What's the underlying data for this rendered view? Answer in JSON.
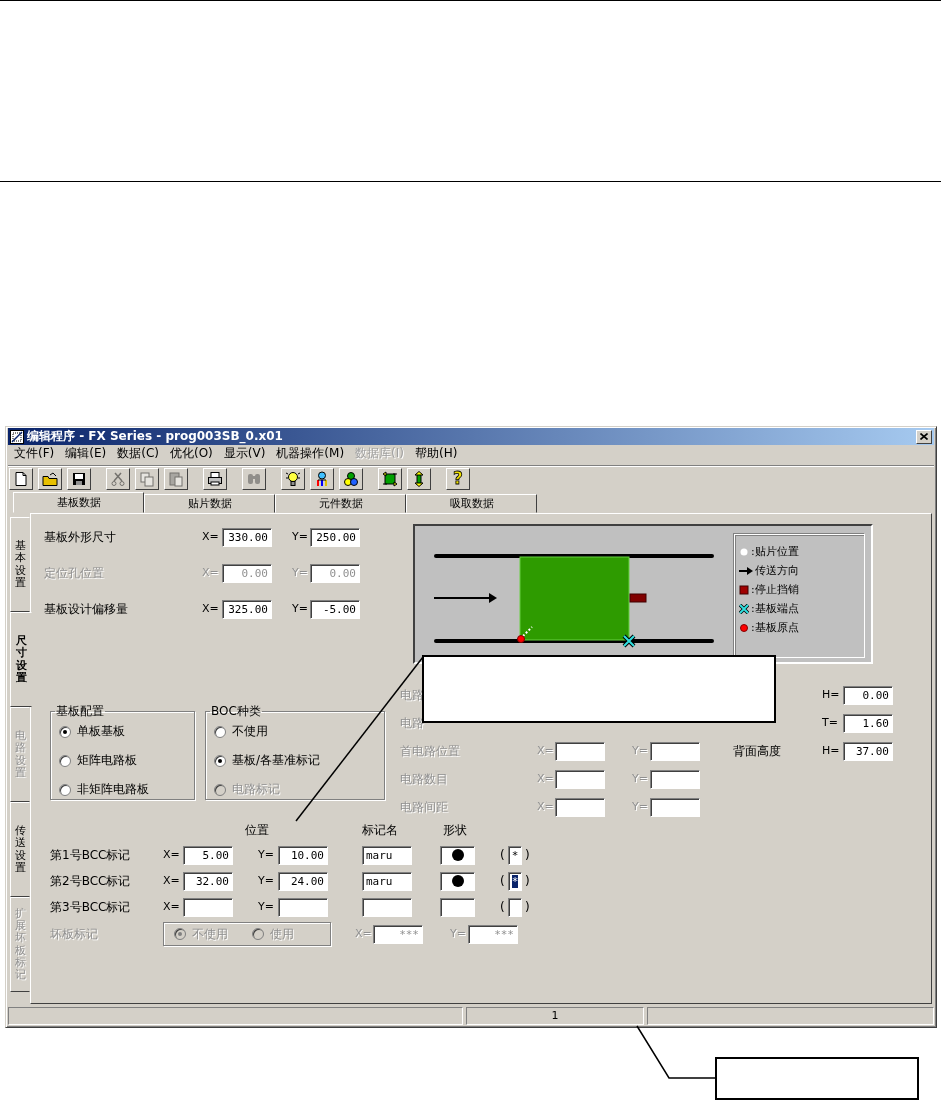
{
  "window": {
    "title": "编辑程序 - FX Series - prog003SB_0.x01"
  },
  "menu": [
    {
      "label": "文件(F)",
      "disabled": false
    },
    {
      "label": "编辑(E)",
      "disabled": false
    },
    {
      "label": "数据(C)",
      "disabled": false
    },
    {
      "label": "优化(O)",
      "disabled": false
    },
    {
      "label": "显示(V)",
      "disabled": false
    },
    {
      "label": "机器操作(M)",
      "disabled": false
    },
    {
      "label": "数据库(I)",
      "disabled": true
    },
    {
      "label": "帮助(H)",
      "disabled": false
    }
  ],
  "toolbar_groups": [
    [
      {
        "kind": "new",
        "disabled": false
      },
      {
        "kind": "open",
        "disabled": false
      },
      {
        "kind": "save",
        "disabled": false
      }
    ],
    [
      {
        "kind": "cut",
        "disabled": true
      },
      {
        "kind": "copy",
        "disabled": true
      },
      {
        "kind": "paste",
        "disabled": true
      }
    ],
    [
      {
        "kind": "print",
        "disabled": false
      }
    ],
    [
      {
        "kind": "find",
        "disabled": true
      }
    ],
    [
      {
        "kind": "bulb",
        "disabled": false
      },
      {
        "kind": "network",
        "disabled": false
      },
      {
        "kind": "shapes",
        "disabled": false
      }
    ],
    [
      {
        "kind": "swap",
        "disabled": false
      },
      {
        "kind": "height",
        "disabled": false
      }
    ],
    [
      {
        "kind": "help",
        "glyph": "?",
        "disabled": false
      }
    ]
  ],
  "tabs": [
    {
      "label": "基板数据",
      "selected": true
    },
    {
      "label": "贴片数据",
      "selected": false
    },
    {
      "label": "元件数据",
      "selected": false
    },
    {
      "label": "吸取数据",
      "selected": false
    }
  ],
  "side_tabs": [
    {
      "label": "基本设置",
      "selected": false,
      "disabled": false
    },
    {
      "label": "尺寸设置",
      "selected": true,
      "disabled": false
    },
    {
      "label": "电路设置",
      "selected": false,
      "disabled": true
    },
    {
      "label": "传送设置",
      "selected": false,
      "disabled": false
    },
    {
      "label": "扩展坏板标记",
      "selected": false,
      "disabled": true
    }
  ],
  "board_fields": [
    {
      "label": "基板外形尺寸",
      "disabled": false,
      "x": {
        "label": "X=",
        "value": "330.00"
      },
      "y": {
        "label": "Y=",
        "value": "250.00"
      }
    },
    {
      "label": "定位孔位置",
      "disabled": true,
      "x": {
        "label": "X=",
        "value": "0.00"
      },
      "y": {
        "label": "Y=",
        "value": "0.00"
      }
    },
    {
      "label": "基板设计偏移量",
      "disabled": false,
      "x": {
        "label": "X=",
        "value": "325.00"
      },
      "y": {
        "label": "Y=",
        "value": "-5.00"
      }
    }
  ],
  "diagram": {
    "legend": [
      {
        "kind": "dot",
        "label": ":贴片位置"
      },
      {
        "kind": "arrow",
        "label": "传送方向"
      },
      {
        "kind": "pin",
        "label": ":停止挡销"
      },
      {
        "kind": "cross",
        "label": ":基板端点"
      },
      {
        "kind": "origin",
        "label": ":基板原点"
      }
    ]
  },
  "layout_group": {
    "title": "基板配置",
    "options": [
      {
        "label": "单板基板",
        "selected": true,
        "disabled": false
      },
      {
        "label": "矩阵电路板",
        "selected": false,
        "disabled": false
      },
      {
        "label": "非矩阵电路板",
        "selected": false,
        "disabled": false
      }
    ]
  },
  "boc_group": {
    "title": "BOC种类",
    "options": [
      {
        "label": "不使用",
        "selected": false,
        "disabled": false
      },
      {
        "label": "基板/各基准标记",
        "selected": true,
        "disabled": false
      },
      {
        "label": "电路标记",
        "selected": false,
        "disabled": true
      }
    ]
  },
  "circuit_fields": [
    {
      "label": "电路"
    },
    {
      "label": "电路"
    },
    {
      "label": "首电路位置",
      "x_label": "X=",
      "y_label": "Y="
    },
    {
      "label": "电路数目",
      "x_label": "X=",
      "y_label": "Y="
    },
    {
      "label": "电路间距",
      "x_label": "X=",
      "y_label": "Y="
    }
  ],
  "height_fields": [
    {
      "label": "H=",
      "value": "0.00"
    },
    {
      "label": "T=",
      "value": "1.60"
    },
    {
      "name": "背面高度",
      "label": "H=",
      "value": "37.00"
    }
  ],
  "bcc": {
    "headers": [
      "位置",
      "标记名",
      "形状"
    ],
    "rows": [
      {
        "label": "第1号BCC标记",
        "x": {
          "label": "X=",
          "value": "5.00"
        },
        "y": {
          "label": "Y=",
          "value": "10.00"
        },
        "mark_name": "maru",
        "shape": {
          "kind": "circle"
        },
        "parens": [
          "(",
          ")"
        ],
        "mark": "*",
        "mark_selected": false
      },
      {
        "label": "第2号BCC标记",
        "x": {
          "label": "X=",
          "value": "32.00"
        },
        "y": {
          "label": "Y=",
          "value": "24.00"
        },
        "mark_name": "maru",
        "shape": {
          "kind": "circle"
        },
        "parens": [
          "(",
          ")"
        ],
        "mark": "*",
        "mark_selected": true
      },
      {
        "label": "第3号BCC标记",
        "x": {
          "label": "X="
        },
        "y": {
          "label": "Y="
        },
        "parens": [
          "(",
          ")"
        ]
      }
    ]
  },
  "bad_board": {
    "label": "坏板标记",
    "options": [
      {
        "label": "不使用",
        "selected": true
      },
      {
        "label": "使用",
        "selected": false
      }
    ],
    "x": {
      "label": "X=",
      "value": "***"
    },
    "y": {
      "label": "Y=",
      "value": "***"
    }
  },
  "status_bar": {
    "panel_2": "1"
  }
}
